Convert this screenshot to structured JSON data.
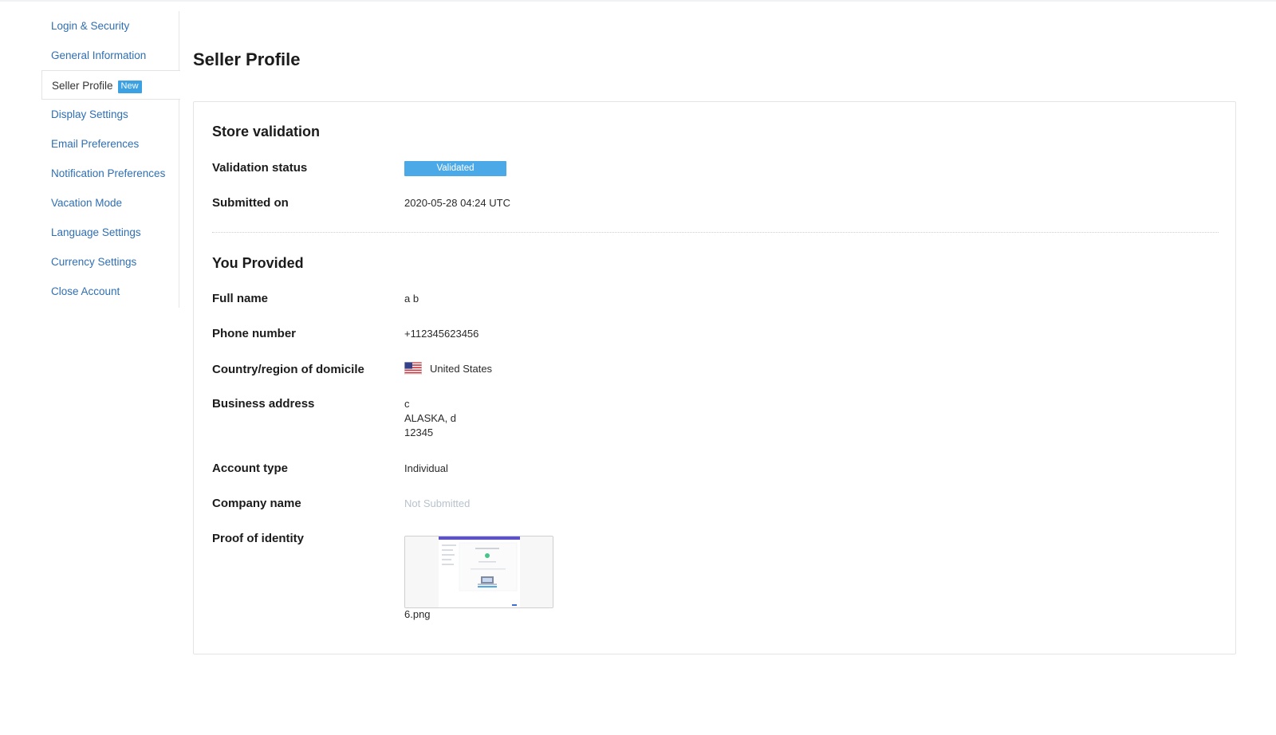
{
  "sidebar": {
    "items": [
      {
        "label": "Login & Security"
      },
      {
        "label": "General Information"
      },
      {
        "label": "Seller Profile",
        "badge": "New",
        "active": true
      },
      {
        "label": "Display Settings"
      },
      {
        "label": "Email Preferences"
      },
      {
        "label": "Notification Preferences"
      },
      {
        "label": "Vacation Mode"
      },
      {
        "label": "Language Settings"
      },
      {
        "label": "Currency Settings"
      },
      {
        "label": "Close Account"
      }
    ]
  },
  "page": {
    "title": "Seller Profile"
  },
  "store_validation": {
    "heading": "Store validation",
    "status_label": "Validation status",
    "status_value": "Validated",
    "submitted_label": "Submitted on",
    "submitted_value": "2020-05-28 04:24 UTC"
  },
  "provided": {
    "heading": "You Provided",
    "full_name_label": "Full name",
    "full_name_value": "a b",
    "phone_label": "Phone number",
    "phone_value": "+112345623456",
    "country_label": "Country/region of domicile",
    "country_value": "United States",
    "country_flag_icon": "us-flag-icon",
    "address_label": "Business address",
    "address_lines": [
      "c",
      "ALASKA, d",
      "12345"
    ],
    "account_type_label": "Account type",
    "account_type_value": "Individual",
    "company_label": "Company name",
    "company_value": "Not Submitted",
    "proof_label": "Proof of identity",
    "proof_filename": "6.png"
  },
  "colors": {
    "link": "#2f6fb3",
    "badge": "#3ca1e3",
    "status": "#4aa9e6",
    "muted": "#b9c3cd"
  }
}
